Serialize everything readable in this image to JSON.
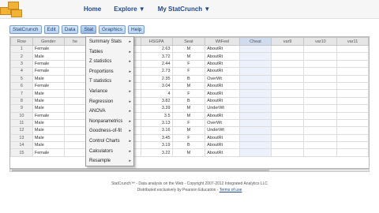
{
  "nav": {
    "links": [
      "Home",
      "Explore ▼",
      "My StatCrunch ▼"
    ]
  },
  "menu": {
    "items": [
      "StatCrunch",
      "Edit",
      "Data",
      "Stat",
      "Graphics",
      "Help"
    ],
    "active_index": 3
  },
  "grid": {
    "columns": [
      "Row",
      "Gender",
      "he",
      "",
      "HSGPA",
      "Seat",
      "WtFeel",
      "Cheat",
      "var9",
      "var10",
      "var11"
    ],
    "rows": [
      [
        "1",
        "Female",
        "",
        "",
        "2.63",
        "M",
        "AboutRt",
        "",
        "",
        "",
        ""
      ],
      [
        "2",
        "Male",
        "",
        "",
        "3.72",
        "M",
        "AboutRt",
        "",
        "",
        "",
        ""
      ],
      [
        "3",
        "Female",
        "",
        "",
        "2.44",
        "F",
        "AboutRt",
        "",
        "",
        "",
        ""
      ],
      [
        "4",
        "Female",
        "",
        "",
        "2.73",
        "F",
        "AboutRt",
        "",
        "",
        "",
        ""
      ],
      [
        "5",
        "Male",
        "",
        "",
        "2.35",
        "B",
        "OverWt",
        "",
        "",
        "",
        ""
      ],
      [
        "6",
        "Female",
        "",
        "",
        "3.04",
        "M",
        "AboutRt",
        "",
        "",
        "",
        ""
      ],
      [
        "7",
        "Male",
        "",
        "",
        "4",
        "F",
        "AboutRt",
        "",
        "",
        "",
        ""
      ],
      [
        "8",
        "Male",
        "",
        "",
        "3.82",
        "B",
        "AboutRt",
        "",
        "",
        "",
        ""
      ],
      [
        "9",
        "Male",
        "",
        "",
        "3.39",
        "M",
        "UnderWt",
        "",
        "",
        "",
        ""
      ],
      [
        "10",
        "Female",
        "",
        "",
        "3.5",
        "M",
        "AboutRt",
        "",
        "",
        "",
        ""
      ],
      [
        "11",
        "Male",
        "",
        "",
        "3.13",
        "F",
        "OverWt",
        "",
        "",
        "",
        ""
      ],
      [
        "12",
        "Male",
        "",
        "",
        "3.16",
        "M",
        "UnderWt",
        "",
        "",
        "",
        ""
      ],
      [
        "13",
        "Male",
        "",
        "",
        "3.45",
        "F",
        "AboutRt",
        "",
        "",
        "",
        ""
      ],
      [
        "14",
        "Male",
        "",
        "",
        "3.19",
        "B",
        "AboutRt",
        "",
        "",
        "",
        ""
      ],
      [
        "15",
        "Female",
        "",
        "",
        "3.22",
        "M",
        "AboutRt",
        "",
        "",
        "",
        ""
      ]
    ]
  },
  "stat_menu": {
    "items": [
      {
        "label": "Summary Stats",
        "submenu": true
      },
      {
        "label": "Tables",
        "submenu": true
      },
      {
        "label": "Z statistics",
        "submenu": true
      },
      {
        "label": "Proportions",
        "submenu": true
      },
      {
        "label": "T statistics",
        "submenu": true
      },
      {
        "label": "Variance",
        "submenu": true
      },
      {
        "label": "Regression",
        "submenu": true
      },
      {
        "label": "ANOVA",
        "submenu": true
      },
      {
        "label": "Nonparametrics",
        "submenu": true
      },
      {
        "label": "Goodness-of-fit",
        "submenu": true
      },
      {
        "label": "Control Charts",
        "submenu": true
      },
      {
        "label": "Calculators",
        "submenu": true
      },
      {
        "label": "Resample",
        "submenu": true
      }
    ]
  },
  "footer": {
    "line1": "StatCrunch™ - Data analysis on the Web - Copyright 2007-2012 Integrated Analytics LLC",
    "line2_prefix": "Distributed exclusively by Pearson Education - ",
    "terms_link": "Terms of use"
  },
  "colors": {
    "nav_text": "#234a88",
    "menu_button": "#b6d0ee",
    "logo": "#f2b233"
  }
}
